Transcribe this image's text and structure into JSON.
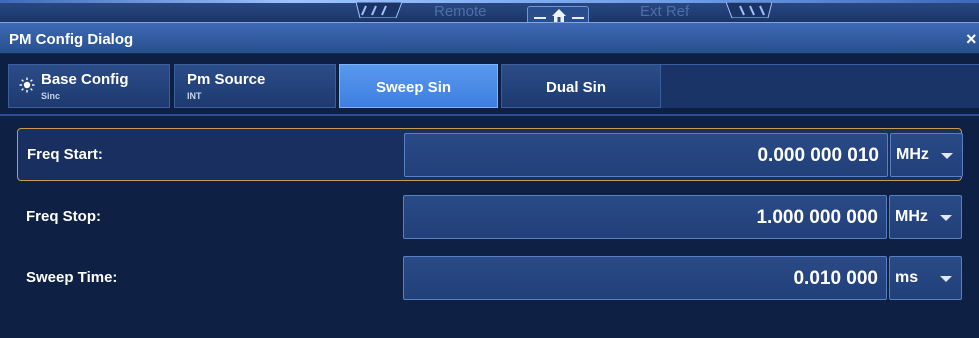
{
  "status_bar": {
    "remote_label": "Remote",
    "ext_ref_label": "Ext Ref"
  },
  "dialog": {
    "title": "PM Config Dialog",
    "close_symbol": "×"
  },
  "tabs": [
    {
      "label": "Base Config",
      "sub": "Sinc",
      "icon": "sun-icon",
      "active": false
    },
    {
      "label": "Pm Source",
      "sub": "INT",
      "active": false
    },
    {
      "label": "Sweep Sin",
      "sub": "",
      "active": true
    },
    {
      "label": "Dual Sin",
      "sub": "",
      "active": false
    }
  ],
  "fields": [
    {
      "label": "Freq Start:",
      "value": "0.000 000 010",
      "unit": "MHz",
      "focused": true
    },
    {
      "label": "Freq Stop:",
      "value": "1.000 000 000",
      "unit": "MHz",
      "focused": false
    },
    {
      "label": "Sweep Time:",
      "value": "0.010 000",
      "unit": "ms",
      "focused": false
    }
  ],
  "colors": {
    "active_tab": "#4a8ae8",
    "focus_border": "#c99a55",
    "background": "#0f2045"
  }
}
